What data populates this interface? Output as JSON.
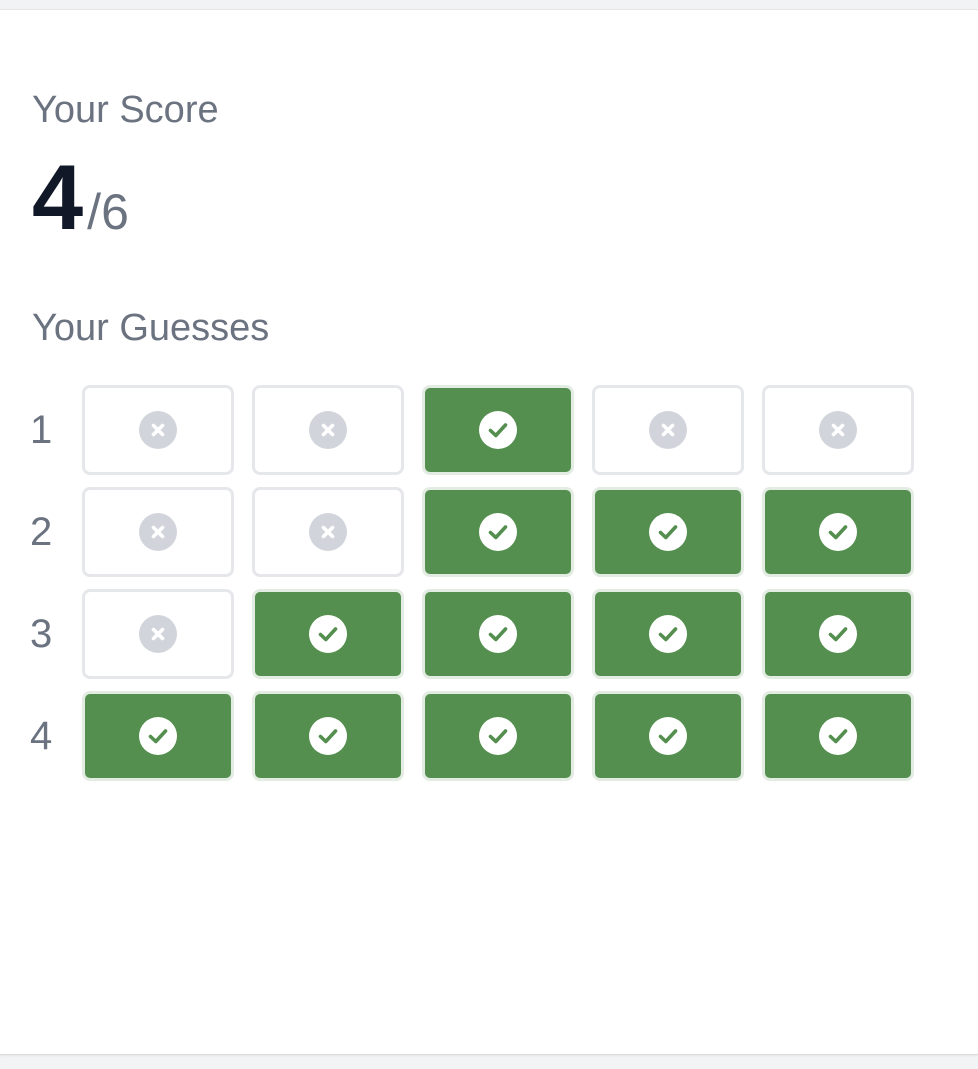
{
  "score": {
    "label": "Your Score",
    "value": "4",
    "total": "/6"
  },
  "guesses": {
    "label": "Your Guesses",
    "rows": [
      {
        "number": "1",
        "cells": [
          false,
          false,
          true,
          false,
          false
        ]
      },
      {
        "number": "2",
        "cells": [
          false,
          false,
          true,
          true,
          true
        ]
      },
      {
        "number": "3",
        "cells": [
          false,
          true,
          true,
          true,
          true
        ]
      },
      {
        "number": "4",
        "cells": [
          true,
          true,
          true,
          true,
          true
        ]
      }
    ]
  },
  "colors": {
    "correct": "#548f4f",
    "incorrect_icon": "#d1d5db"
  },
  "icons": {
    "correct": "check-circle-icon",
    "incorrect": "x-circle-icon"
  }
}
